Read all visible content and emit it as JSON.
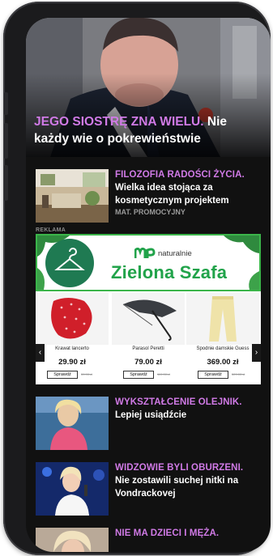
{
  "hero": {
    "highlight": "JEGO SIOSTRĘ ZNA WIELU.",
    "rest": " Nie każdy wie o pokrewieństwie"
  },
  "ad_label": "REKLAMA",
  "ad": {
    "logo_text": "naturalnie",
    "brand": "Zielona Szafa",
    "products": [
      {
        "name": "Krawat lancerto",
        "price": "29.90 zł",
        "button": "Sprawdź",
        "old_price": "39.90 zł"
      },
      {
        "name": "Parasol Peretti",
        "price": "79.00 zł",
        "button": "Sprawdź",
        "old_price": "119.00 zł"
      },
      {
        "name": "Spodnie damskie Guess",
        "price": "369.00 zł",
        "button": "Sprawdź",
        "old_price": "529.00 zł"
      }
    ]
  },
  "articles": [
    {
      "kicker": "FILOZOFIA RADOŚCI ŻYCIA.",
      "title": "Wielka idea stojąca za kosmetycznym projektem",
      "sponsor": "MAT. PROMOCYJNY"
    },
    {
      "kicker": "WYKSZTAŁCENIE OLEJNIK.",
      "title": "Lepiej usiądźcie"
    },
    {
      "kicker": "WIDZOWIE BYLI OBURZENI.",
      "title": "Nie zostawili suchej nitki na Vondrackovej"
    },
    {
      "kicker": "NIE MA DZIECI I MĘŻA."
    }
  ]
}
